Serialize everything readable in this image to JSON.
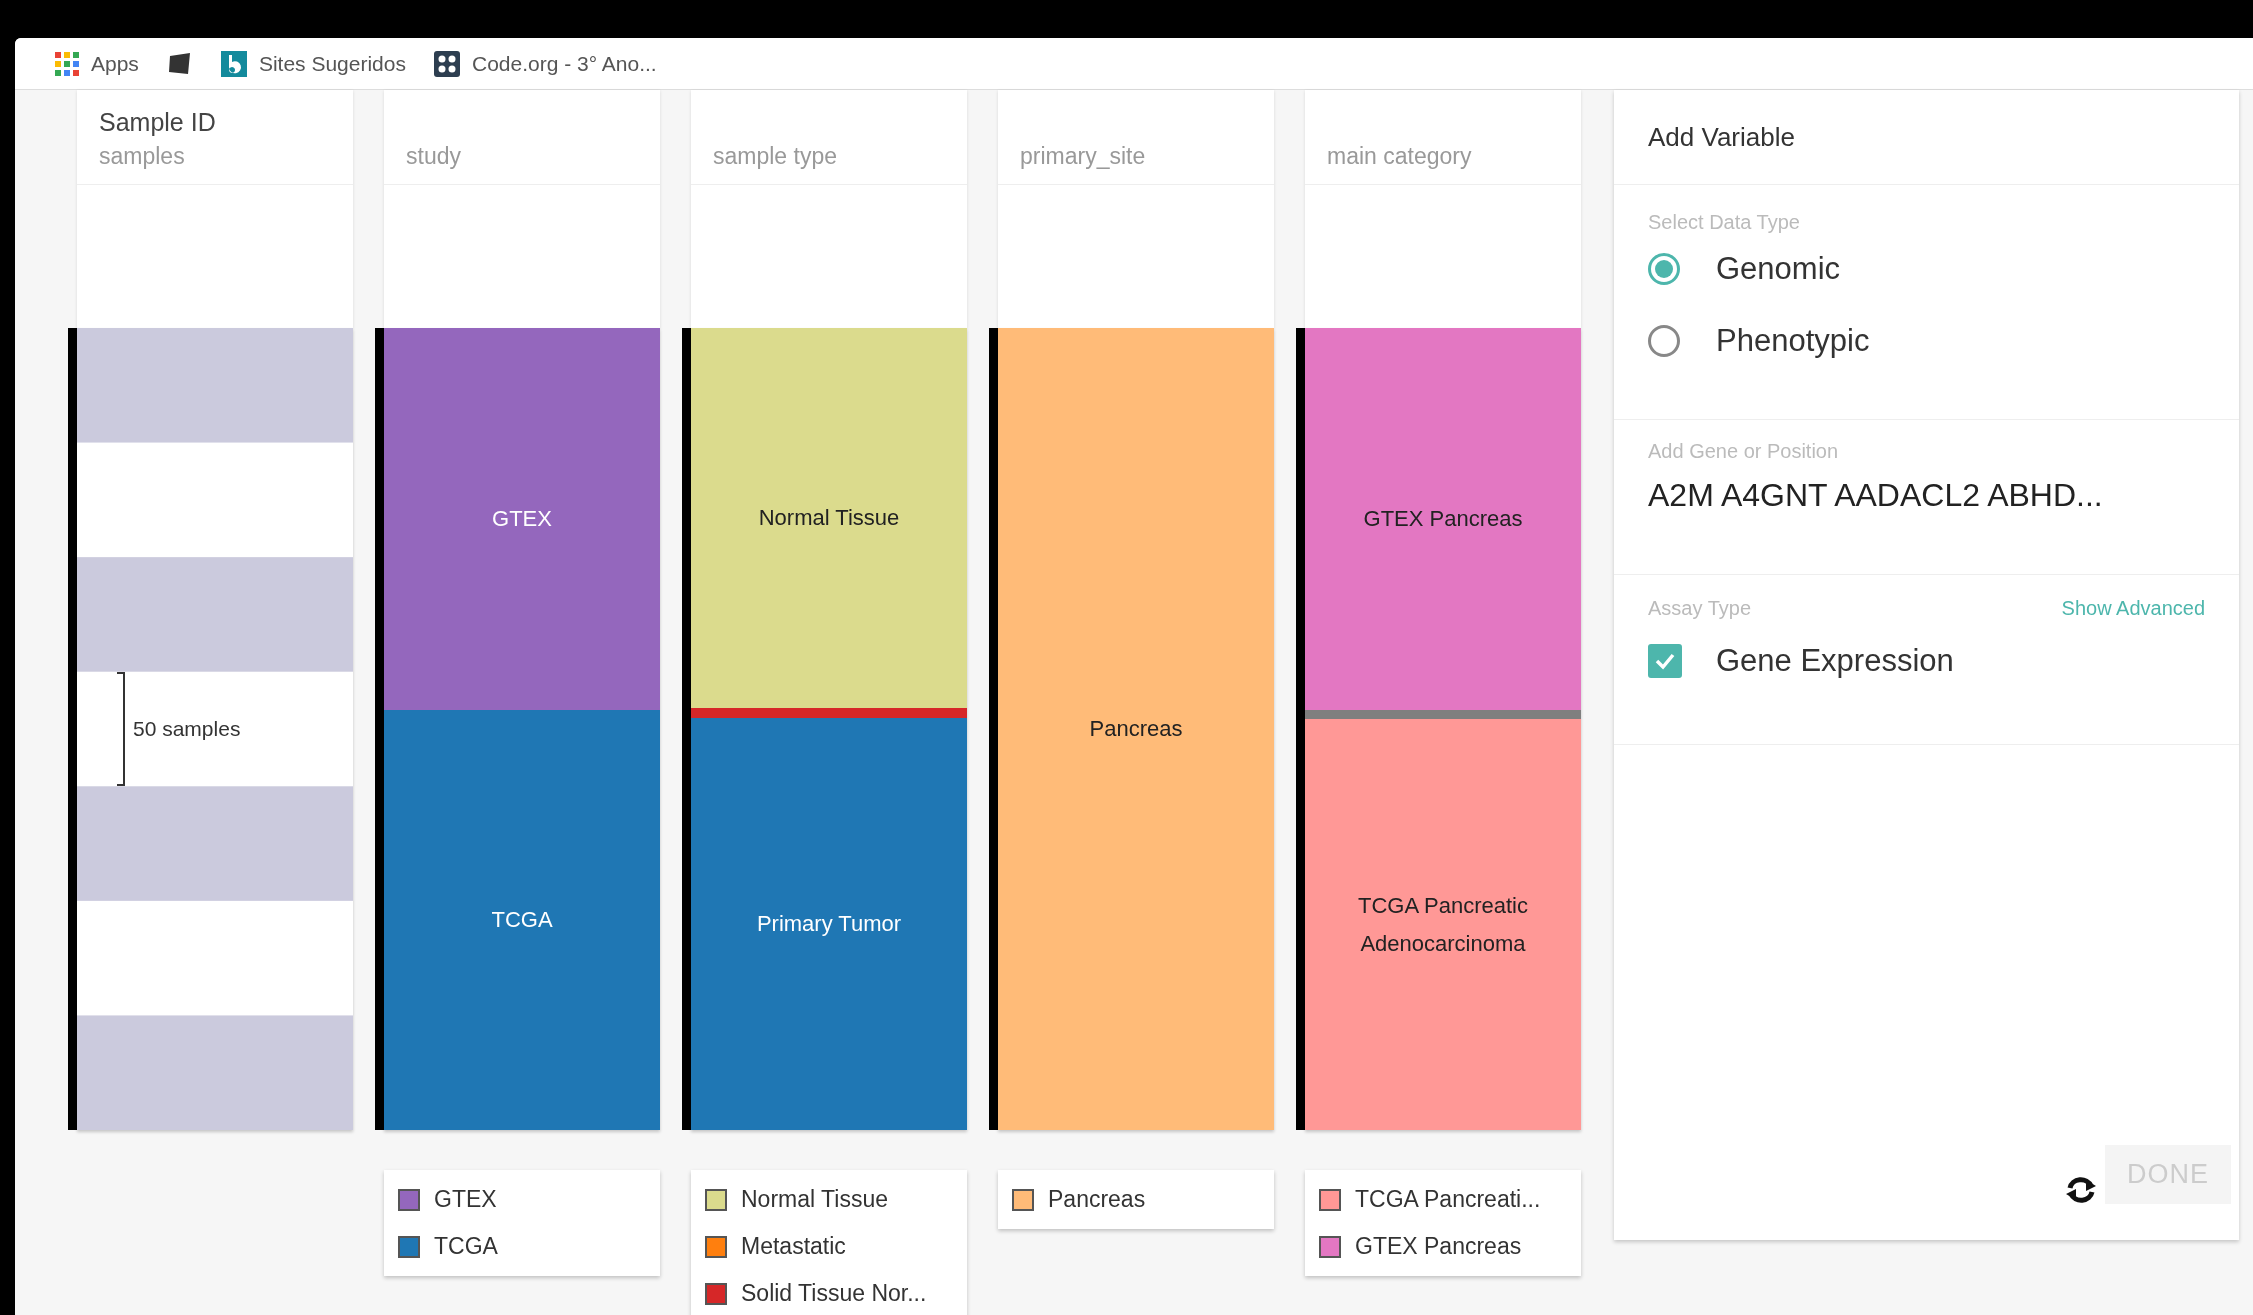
{
  "bookmarks_bar": {
    "items": [
      {
        "kind": "apps",
        "label": "Apps"
      },
      {
        "kind": "plain"
      },
      {
        "kind": "bing",
        "label": "Sites Sugeridos"
      },
      {
        "kind": "codeorg",
        "label": "Code.org - 3° Ano..."
      }
    ]
  },
  "columns": [
    {
      "kind": "samples",
      "title": "Sample ID",
      "field": "samples",
      "annotation": "50 samples"
    },
    {
      "kind": "categorical",
      "field": "study",
      "segments": [
        {
          "label": "GTEX",
          "color": "#9467bd",
          "level": 0.476
        },
        {
          "label": "TCGA",
          "color": "#1f77b4",
          "level": 0.524
        }
      ],
      "legend": [
        {
          "label": "GTEX",
          "color": "#9467bd"
        },
        {
          "label": "TCGA",
          "color": "#1f77b4"
        }
      ]
    },
    {
      "kind": "categorical",
      "field": "sample type",
      "segments": [
        {
          "label": "Normal Tissue",
          "color": "#dbdb8d",
          "level": 0.474
        },
        {
          "color": "#d62728",
          "level": 0.012
        },
        {
          "label": "Primary Tumor",
          "color": "#1f77b4",
          "level": 0.514
        }
      ],
      "legend": [
        {
          "label": "Normal Tissue",
          "color": "#dbdb8d"
        },
        {
          "label": "Metastatic",
          "color": "#ff7f0e"
        },
        {
          "label": "Solid Tissue Nor...",
          "color": "#d62728"
        }
      ]
    },
    {
      "kind": "categorical",
      "field": "primary_site",
      "segments": [
        {
          "label": "Pancreas",
          "color": "#ffbb78",
          "level": 1
        }
      ],
      "legend": [
        {
          "label": "Pancreas",
          "color": "#ffbb78"
        }
      ]
    },
    {
      "kind": "categorical",
      "field": "main category",
      "segments": [
        {
          "label": "GTEX Pancreas",
          "color": "#e377c2",
          "level": 0.476
        },
        {
          "color": "#7f7f7f",
          "level": 0.012
        },
        {
          "label": "TCGA Pancreatic Adenocarcinoma",
          "color": "#ff9896",
          "level": 0.512
        }
      ],
      "legend": [
        {
          "label": "TCGA Pancreati...",
          "color": "#ff9896"
        },
        {
          "label": "GTEX Pancreas",
          "color": "#e377c2"
        }
      ]
    }
  ],
  "panel": {
    "title": "Add Variable",
    "data_type": {
      "label": "Select Data Type",
      "options": [
        {
          "label": "Genomic",
          "selected": true
        },
        {
          "label": "Phenotypic",
          "selected": false
        }
      ]
    },
    "gene_field": {
      "label": "Add Gene or Position",
      "value": "A2M A4GNT AADACL2 ABHD..."
    },
    "assay": {
      "label": "Assay Type",
      "link": "Show Advanced",
      "options": [
        {
          "label": "Gene Expression",
          "checked": true
        }
      ]
    },
    "done_button": {
      "label": "DONE",
      "disabled": true
    }
  }
}
